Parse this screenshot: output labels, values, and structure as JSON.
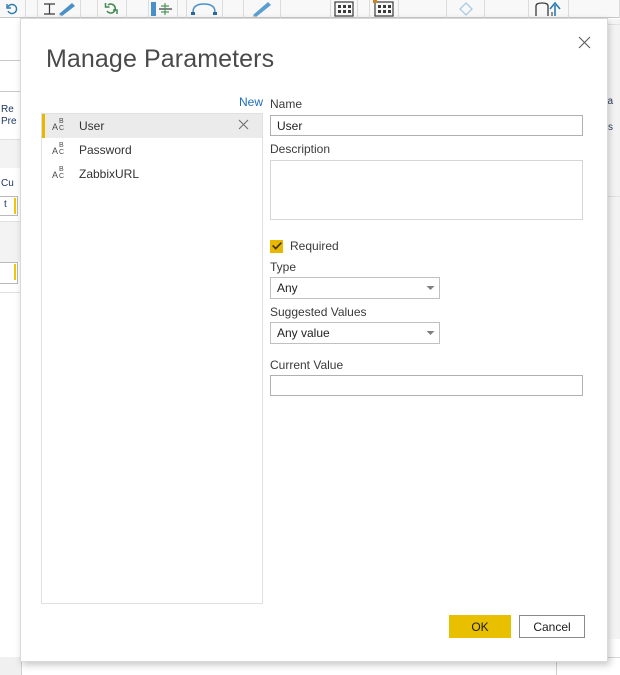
{
  "background": {
    "ribbon_icons": [
      "refresh-icon",
      "pencil-edit-icon",
      "refresh-circular-icon",
      "column-split-icon",
      "group-by-icon",
      "data-type-icon",
      "pencil-blue-icon",
      "table-grid-icon",
      "table-grid-orange-icon",
      "diamond-icon",
      "merge-icon",
      "append-icon"
    ],
    "left_fragments": [
      "Re",
      "Pre",
      "Cu",
      "t"
    ],
    "right_fragments": [
      "a",
      "s"
    ]
  },
  "dialog": {
    "title": "Manage Parameters",
    "close_icon": "close-icon",
    "new_link": "New",
    "parameter_list": {
      "items": [
        {
          "icon": "abc-text-type-icon",
          "label": "User",
          "selected": true,
          "delete_icon": "close-icon"
        },
        {
          "icon": "abc-text-type-icon",
          "label": "Password",
          "selected": false,
          "delete_icon": "close-icon"
        },
        {
          "icon": "abc-text-type-icon",
          "label": "ZabbixURL",
          "selected": false,
          "delete_icon": "close-icon"
        }
      ]
    },
    "fields": {
      "name_label": "Name",
      "name_value": "User",
      "description_label": "Description",
      "description_value": "",
      "required_label": "Required",
      "required_checked": true,
      "required_check_icon": "checkmark-icon",
      "type_label": "Type",
      "type_value": "Any",
      "suggested_values_label": "Suggested Values",
      "suggested_values_value": "Any value",
      "current_value_label": "Current Value",
      "current_value_value": "",
      "dropdown_icon": "chevron-down-icon"
    },
    "footer": {
      "ok_label": "OK",
      "cancel_label": "Cancel"
    }
  },
  "colors": {
    "accent_yellow": "#E8C000",
    "selected_accent": "#E8B800",
    "link_blue": "#1A6EC0",
    "dialog_bg": "#FFFFFF",
    "title_text": "#4A4A4A"
  }
}
